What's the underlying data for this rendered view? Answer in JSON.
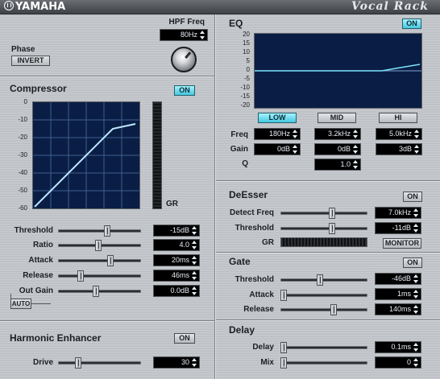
{
  "header": {
    "brand": "YAMAHA",
    "product": "Vocal Rack"
  },
  "phase": {
    "label": "Phase",
    "button": "INVERT"
  },
  "hpf": {
    "label": "HPF Freq",
    "value": "80Hz"
  },
  "compressor": {
    "title": "Compressor",
    "on_label": "ON",
    "ticks": [
      "0",
      "-10",
      "-20",
      "-30",
      "-40",
      "-50",
      "-60"
    ],
    "gr_label": "GR",
    "params": [
      {
        "label": "Threshold",
        "value": "-15dB",
        "level": 0.6
      },
      {
        "label": "Ratio",
        "value": "4.0",
        "level": 0.48
      },
      {
        "label": "Attack",
        "value": "20ms",
        "level": 0.64
      },
      {
        "label": "Release",
        "value": "46ms",
        "level": 0.25
      },
      {
        "label": "Out Gain",
        "value": "0.0dB",
        "level": 0.45
      }
    ],
    "auto_label": "AUTO"
  },
  "harmonic": {
    "title": "Harmonic Enhancer",
    "on_label": "ON",
    "drive_label": "Drive",
    "drive_value": "30",
    "drive_level": 0.22
  },
  "eq": {
    "title": "EQ",
    "on_label": "ON",
    "ticks": [
      "20",
      "15",
      "10",
      "5",
      "0",
      "-5",
      "-10",
      "-15",
      "-20"
    ],
    "bands": [
      "LOW",
      "MID",
      "HI"
    ],
    "freq_label": "Freq",
    "gain_label": "Gain",
    "q_label": "Q",
    "freq": [
      "180Hz",
      "3.2kHz",
      "5.0kHz"
    ],
    "gain": [
      "0dB",
      "0dB",
      "3dB"
    ],
    "q": "1.0"
  },
  "deesser": {
    "title": "DeEsser",
    "on_label": "ON",
    "detect_label": "Detect Freq",
    "detect_value": "7.0kHz",
    "detect_level": 0.6,
    "threshold_label": "Threshold",
    "threshold_value": "-11dB",
    "threshold_level": 0.6,
    "gr_label": "GR",
    "monitor_label": "MONITOR"
  },
  "gate": {
    "title": "Gate",
    "on_label": "ON",
    "threshold_label": "Threshold",
    "threshold_value": "-46dB",
    "threshold_level": 0.45,
    "attack_label": "Attack",
    "attack_value": "1ms",
    "attack_level": 0.0,
    "release_label": "Release",
    "release_value": "140ms",
    "release_level": 0.62
  },
  "delay": {
    "title": "Delay",
    "delay_label": "Delay",
    "delay_value": "0.1ms",
    "delay_level": 0.0,
    "mix_label": "Mix",
    "mix_value": "0",
    "mix_level": 0.0
  },
  "colors": {
    "accent_on": "#45c7e0",
    "graph_bg": "#0a1e45",
    "curve": "#bfe9ff"
  }
}
